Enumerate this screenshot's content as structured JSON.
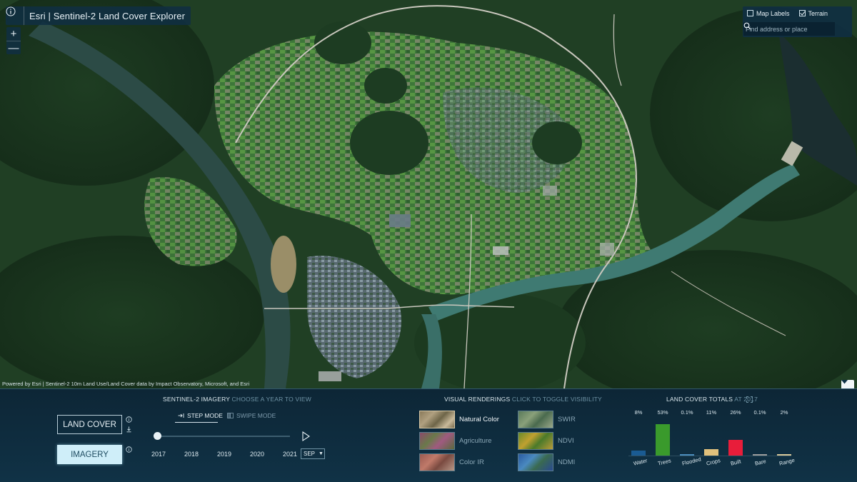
{
  "app": {
    "title": "Esri | Sentinel-2 Land Cover Explorer"
  },
  "map": {
    "zoom_in": "+",
    "zoom_out": "—",
    "layer_toggles": [
      {
        "label": "Map Labels",
        "checked": false
      },
      {
        "label": "Terrain",
        "checked": true
      }
    ],
    "search_placeholder": "Find address or place",
    "attribution": "Powered by Esri | Sentinel-2 10m Land Use/Land Cover data by Impact Observatory, Microsoft, and Esri"
  },
  "panel": {
    "mode_buttons": {
      "land_cover": "LAND COVER",
      "imagery": "IMAGERY",
      "active": "IMAGERY"
    },
    "imagery": {
      "header_bold": "SENTINEL-2 IMAGERY",
      "header_dim": "CHOOSE A YEAR TO VIEW",
      "step_mode": "STEP MODE",
      "swipe_mode": "SWIPE MODE",
      "active_mode": "STEP MODE",
      "years": [
        "2017",
        "2018",
        "2019",
        "2020",
        "2021"
      ],
      "selected_year": "2017",
      "month": "SEP"
    },
    "renderings": {
      "header_bold": "VISUAL RENDERINGS",
      "header_dim": "CLICK TO TOGGLE VISIBILITY",
      "items": [
        {
          "label": "Natural Color",
          "active": true
        },
        {
          "label": "Agriculture",
          "active": false
        },
        {
          "label": "Color IR",
          "active": false
        },
        {
          "label": "SWIR",
          "active": false
        },
        {
          "label": "NDVI",
          "active": false
        },
        {
          "label": "NDMI",
          "active": false
        }
      ]
    },
    "totals": {
      "header_bold": "LAND COVER TOTALS",
      "header_dim": "AT 2017"
    }
  },
  "chart_data": {
    "type": "bar",
    "categories": [
      "Water",
      "Trees",
      "Flooded",
      "Crops",
      "Built",
      "Bare",
      "Range"
    ],
    "values": [
      8,
      53,
      0.1,
      11,
      26,
      0.1,
      2
    ],
    "value_labels": [
      "8%",
      "53%",
      "0.1%",
      "11%",
      "26%",
      "0.1%",
      "2%"
    ],
    "colors": [
      "#1a5b92",
      "#3a9a2c",
      "#4a8cbc",
      "#e0c07c",
      "#e81d3a",
      "#9c9c9c",
      "#d8c89a"
    ],
    "title": "LAND COVER TOTALS AT 2017",
    "xlabel": "",
    "ylabel": "",
    "ylim": [
      0,
      53
    ],
    "grid": false,
    "legend": "none"
  }
}
